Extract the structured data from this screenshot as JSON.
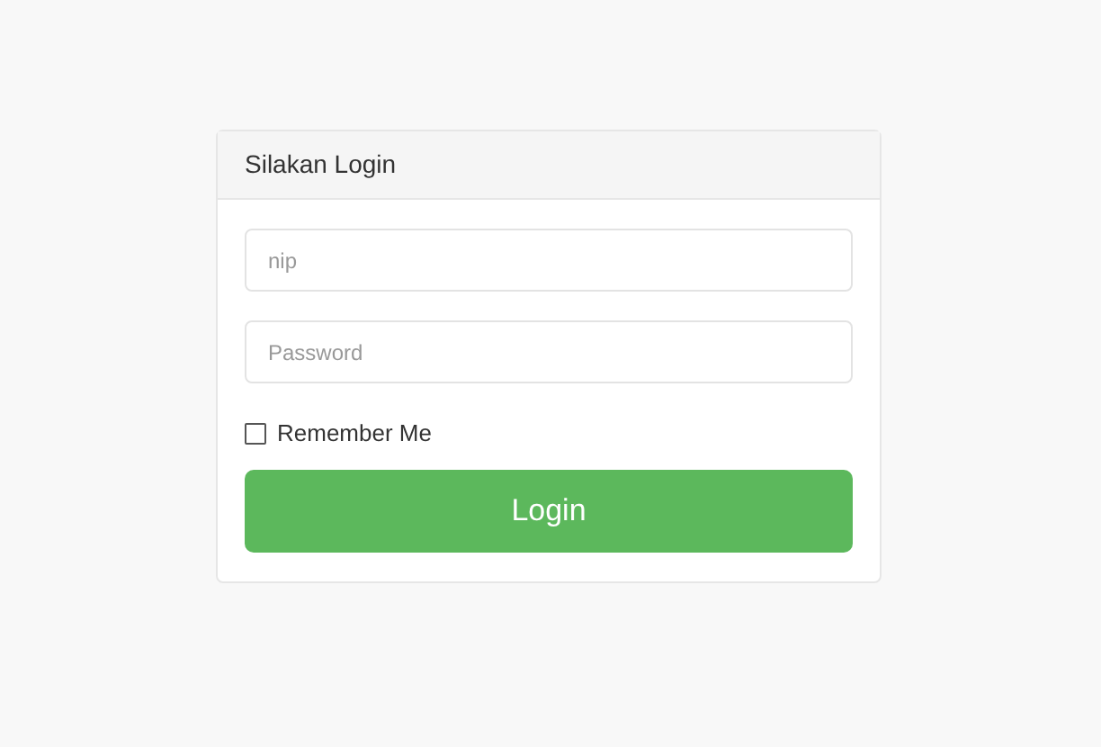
{
  "panel": {
    "title": "Silakan Login"
  },
  "fields": [
    {
      "placeholder": "nip"
    },
    {
      "placeholder": "Password"
    }
  ],
  "remember": {
    "label": "Remember Me",
    "checked": false
  },
  "login_button": {
    "label": "Login"
  }
}
